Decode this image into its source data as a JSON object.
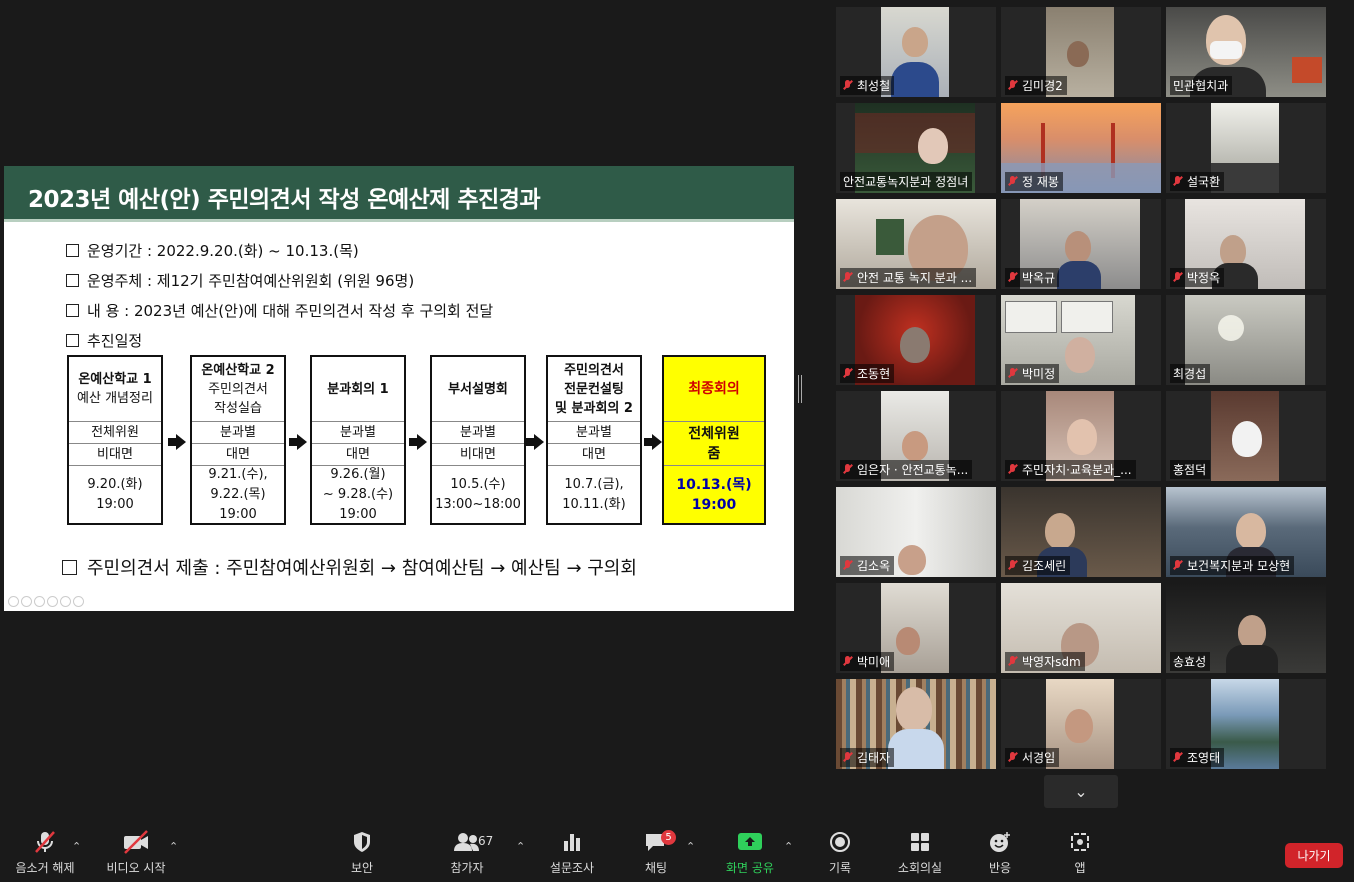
{
  "slide": {
    "title": "2023년 예산(안) 주민의견서 작성 온예산제 추진경과",
    "bullets": [
      "운영기간 : 2022.9.20.(화) ~ 10.13.(목)",
      "운영주체 : 제12기 주민참여예산위원회 (위원 96명)",
      "내 용 : 2023년 예산(안)에 대해 주민의견서 작성 후 구의회 전달",
      "추진일정"
    ],
    "steps": [
      {
        "title": "온예산학교 1",
        "subtitle": "예산 개념정리",
        "who": "전체위원",
        "mode": "비대면",
        "date1": "9.20.(화)",
        "date2": "19:00",
        "date3": ""
      },
      {
        "title": "온예산학교 2",
        "subtitle": "주민의견서",
        "subtitle2": "작성실습",
        "who": "분과별",
        "mode": "대면",
        "date1": "9.21.(수),",
        "date2": "9.22.(목)",
        "date3": "19:00"
      },
      {
        "title": "분과회의 1",
        "who": "분과별",
        "mode": "대면",
        "date1": "9.26.(월)",
        "date2": "~ 9.28.(수)",
        "date3": "19:00"
      },
      {
        "title": "부서설명회",
        "who": "분과별",
        "mode": "비대면",
        "date1": "10.5.(수)",
        "date2": "13:00~18:00",
        "date3": ""
      },
      {
        "title": "주민의견서",
        "title2": "전문컨설팅",
        "title3": "및 분과회의 2",
        "who": "분과별",
        "mode": "대면",
        "date1": "10.7.(금),",
        "date2": "10.11.(화)",
        "date3": ""
      },
      {
        "title": "최종회의",
        "who": "전체위원",
        "mode": "줌",
        "date1": "10.13.(목)",
        "date2": "19:00",
        "date3": ""
      }
    ],
    "submission": "주민의견서 제출 : 주민참여예산위원회 → 참여예산팀 → 예산팀 → 구의회"
  },
  "participants": [
    {
      "name": "최성철",
      "muted": true
    },
    {
      "name": "김미경2",
      "muted": true
    },
    {
      "name": "민관협치과",
      "muted": false,
      "active": true
    },
    {
      "name": "안전교통녹지분과 정점녀",
      "muted": false
    },
    {
      "name": "정 재봉",
      "muted": true
    },
    {
      "name": "설국환",
      "muted": true
    },
    {
      "name": "안전 교통 녹지 분과 ...",
      "muted": true
    },
    {
      "name": "박옥규",
      "muted": true
    },
    {
      "name": "박정옥",
      "muted": true
    },
    {
      "name": "조동현",
      "muted": true
    },
    {
      "name": "박미정",
      "muted": true
    },
    {
      "name": "최경섭",
      "muted": false
    },
    {
      "name": "임은자 · 안전교통녹...",
      "muted": true
    },
    {
      "name": "주민자치·교육분과_...",
      "muted": true
    },
    {
      "name": "홍점덕",
      "muted": false
    },
    {
      "name": "김소옥",
      "muted": true
    },
    {
      "name": "김조세린",
      "muted": true
    },
    {
      "name": "보건복지분과 모상현",
      "muted": true
    },
    {
      "name": "박미애",
      "muted": true
    },
    {
      "name": "박영자sdm",
      "muted": true
    },
    {
      "name": "송효성",
      "muted": false
    },
    {
      "name": "김태자",
      "muted": true
    },
    {
      "name": "서경임",
      "muted": true
    },
    {
      "name": "조영태",
      "muted": true
    }
  ],
  "toolbar": {
    "unmute": "음소거 해제",
    "start_video": "비디오 시작",
    "security": "보안",
    "participants": "참가자",
    "participants_count": "67",
    "polls": "설문조사",
    "chat": "채팅",
    "chat_badge": "5",
    "share_screen": "화면 공유",
    "record": "기록",
    "breakout": "소회의실",
    "reactions": "반응",
    "apps": "앱",
    "leave": "나가기"
  },
  "colors": {
    "slide_header": "#2f5b48",
    "final_box": "#ffff00",
    "share_green": "#2fd05b",
    "leave_red": "#d1242a",
    "active_speaker": "#e3e84a"
  }
}
